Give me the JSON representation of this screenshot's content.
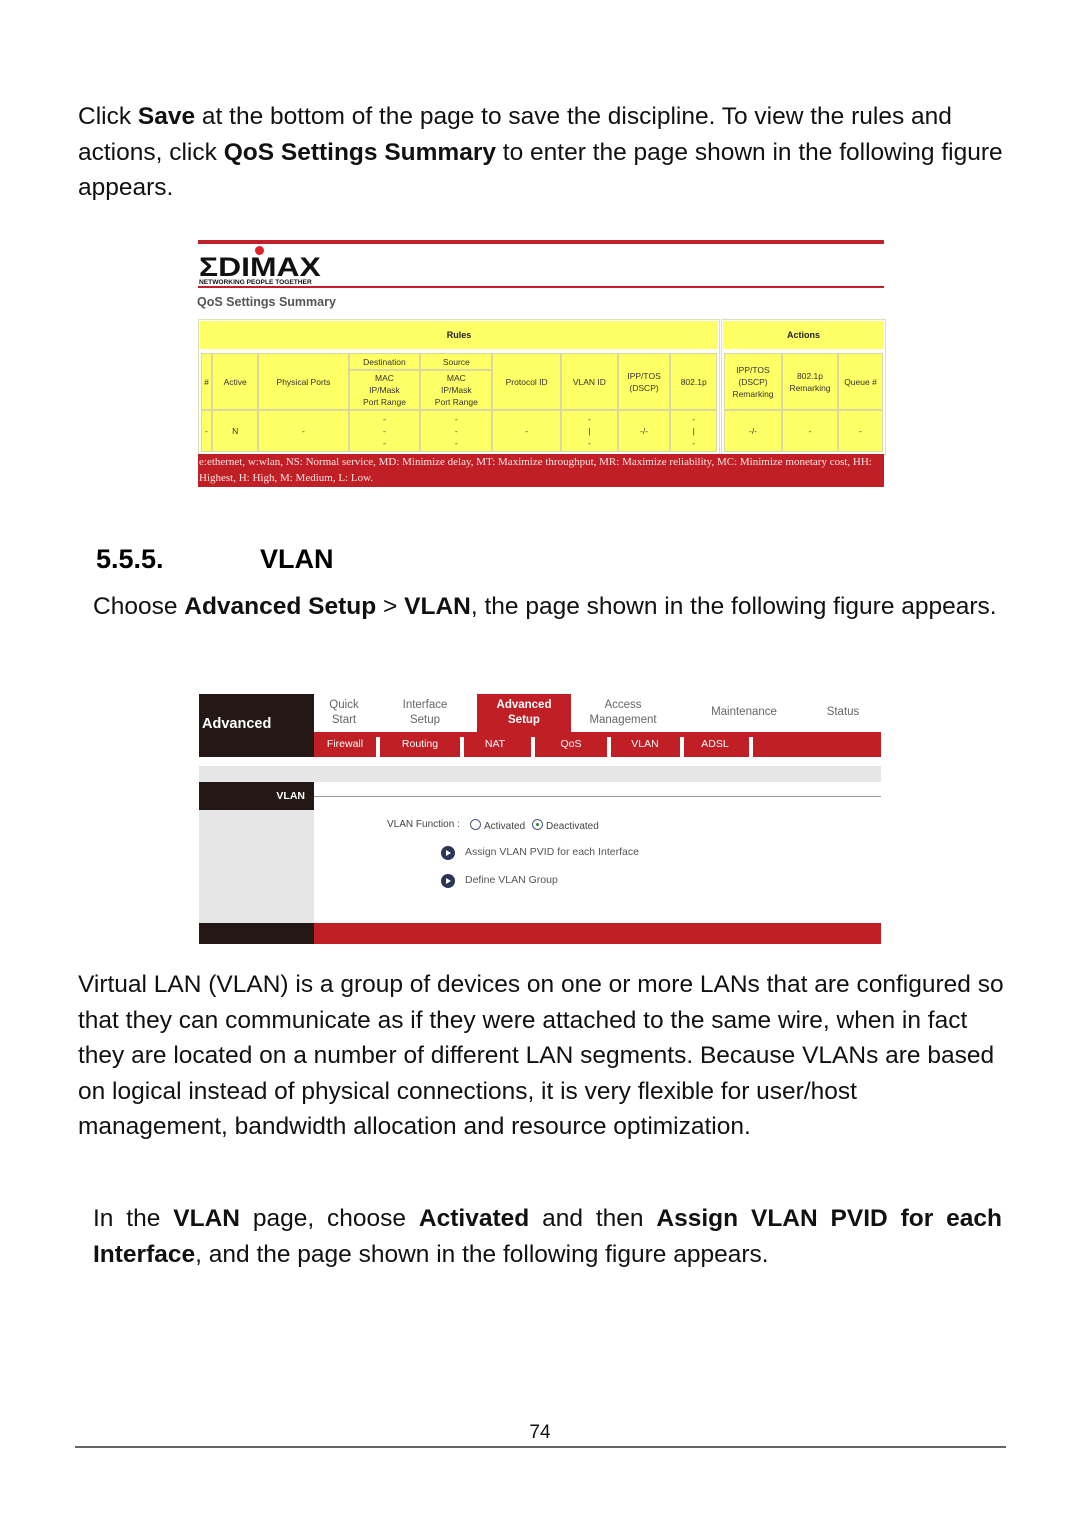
{
  "intro_paragraph": {
    "t1": "Click ",
    "b1": "Save",
    "t2": " at the bottom of the page to save the discipline. To view the rules and actions, click ",
    "b2": "QoS Settings Summary",
    "t3": " to enter the page shown in the following figure appears."
  },
  "qos_figure": {
    "brand": "ΣDIMAX",
    "tagline": "NETWORKING PEOPLE TOGETHER",
    "title": "QoS Settings Summary",
    "rules_header": "Rules",
    "actions_header": "Actions",
    "rules_columns": {
      "num": "#",
      "active": "Active",
      "physical_ports": "Physical Ports",
      "destination": "Destination",
      "source": "Source",
      "dest_sub": [
        "MAC",
        "IP/Mask",
        "Port Range"
      ],
      "src_sub": [
        "MAC",
        "IP/Mask",
        "Port Range"
      ],
      "protocol_id": "Protocol ID",
      "vlan_id": "VLAN ID",
      "ipp_tos": [
        "IPP/TOS",
        "(DSCP)"
      ],
      "p8021": "802.1p"
    },
    "actions_columns": {
      "ipp_tos_remark": [
        "IPP/TOS",
        "(DSCP)",
        "Remarking"
      ],
      "p8021_remark": [
        "802.1p",
        "Remarking"
      ],
      "queue": "Queue #"
    },
    "rule_row": {
      "num": "-",
      "active": "N",
      "physical_ports": "-",
      "dest": [
        "-",
        "-",
        "-"
      ],
      "src": [
        "-",
        "-",
        "-"
      ],
      "protocol_id": "-",
      "vlan_id": [
        "-",
        "|",
        "-"
      ],
      "ipp_tos": "-/-",
      "p8021": [
        "-",
        "|",
        "-"
      ]
    },
    "action_row": {
      "ipp_tos_remark": "-/-",
      "p8021_remark": "-",
      "queue": "-"
    },
    "legend": "e:ethernet, w:wlan, NS: Normal service, MD: Minimize delay, MT: Maximize throughput, MR: Maximize reliability, MC: Minimize monetary cost, HH: Highest, H: High, M: Medium, L: Low."
  },
  "section": {
    "number": "5.5.5.",
    "title": "VLAN"
  },
  "choose_paragraph": {
    "t1": "Choose ",
    "b1": "Advanced Setup",
    "t2": " > ",
    "b2": "VLAN",
    "t3": ", the page shown in the following figure appears."
  },
  "vlan_figure": {
    "brand_label": "Advanced",
    "tabs": [
      {
        "line1": "Quick",
        "line2": "Start"
      },
      {
        "line1": "Interface",
        "line2": "Setup"
      },
      {
        "line1": "Advanced",
        "line2": "Setup"
      },
      {
        "line1": "Access",
        "line2": "Management"
      },
      {
        "line1": "Maintenance",
        "line2": ""
      },
      {
        "line1": "Status",
        "line2": ""
      }
    ],
    "active_tab": "Advanced Setup",
    "subnav": [
      "Firewall",
      "Routing",
      "NAT",
      "QoS",
      "VLAN",
      "ADSL"
    ],
    "active_subnav": "VLAN",
    "side_header": "VLAN",
    "function_label": "VLAN Function :",
    "radio_options": [
      "Activated",
      "Deactivated"
    ],
    "radio_selected": "Deactivated",
    "links": [
      "Assign VLAN PVID for each Interface",
      "Define VLAN Group"
    ]
  },
  "vlan_paragraph": "Virtual LAN (VLAN) is a group of devices on one or more LANs that are configured so that they can communicate as if they were attached to the same wire, when in fact they are located on a number of different LAN segments. Because VLANs are based on logical instead of physical connections, it is very flexible for user/host management, bandwidth allocation and resource optimization.",
  "instruction_paragraph": {
    "t1": "In the ",
    "b1": "VLAN",
    "t2": " page, choose ",
    "b2": "Activated",
    "t3": " and then ",
    "b3": "Assign VLAN PVID for each Interface",
    "t4": ", and the page shown in the following figure appears."
  },
  "footer": {
    "page_number": "74"
  },
  "colors": {
    "brand_red": "#c01f25",
    "table_yellow": "#ffff66",
    "dark_panel": "#231816"
  }
}
